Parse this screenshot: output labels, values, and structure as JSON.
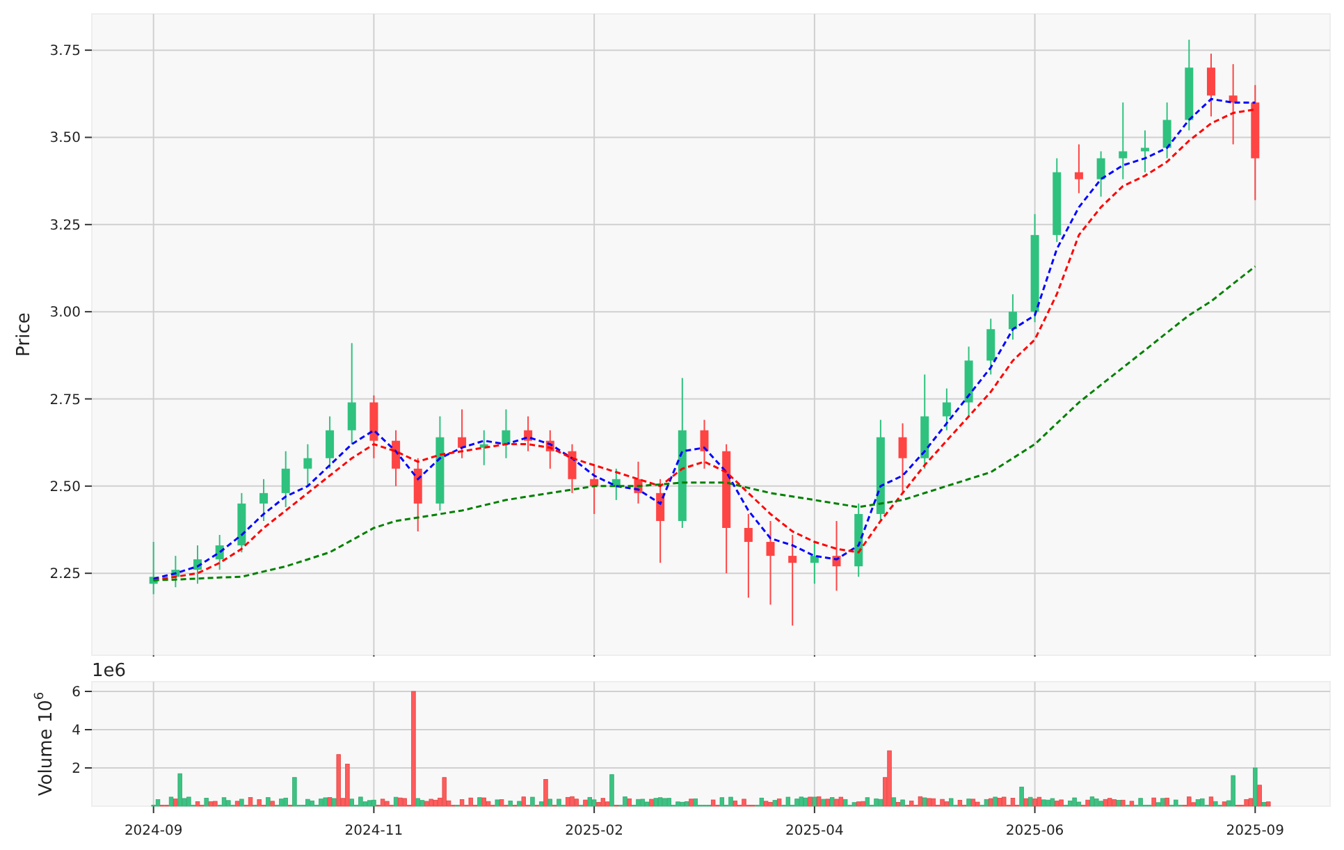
{
  "price_chart": {
    "chart_data": {
      "type": "candlestick",
      "ylabel": "Price",
      "grid": true,
      "categories": [
        null,
        null,
        null,
        null,
        null,
        null,
        null,
        null,
        null,
        null,
        null,
        null,
        null,
        null,
        null,
        null,
        null,
        null,
        null,
        null,
        null,
        null,
        null,
        null,
        null,
        null,
        null,
        null,
        null,
        null,
        null,
        null,
        null,
        null,
        null,
        null,
        null,
        null,
        null,
        null,
        null,
        null,
        null,
        null,
        null,
        null,
        null,
        null,
        null,
        null,
        null
      ],
      "ylim": [
        2.015,
        3.854
      ],
      "yticks": [
        {
          "value": 2.25,
          "label": "2.25"
        },
        {
          "value": 2.5,
          "label": "2.50"
        },
        {
          "value": 2.75,
          "label": "2.75"
        },
        {
          "value": 3,
          "label": "3.00"
        },
        {
          "value": 3.25,
          "label": "3.25"
        },
        {
          "value": 3.5,
          "label": "3.50"
        },
        {
          "value": 3.75,
          "label": "3.75"
        }
      ],
      "ohlc": [
        [
          2.22,
          2.34,
          2.19,
          2.24
        ],
        [
          2.24,
          2.3,
          2.21,
          2.26
        ],
        [
          2.26,
          2.33,
          2.22,
          2.29
        ],
        [
          2.29,
          2.36,
          2.26,
          2.33
        ],
        [
          2.33,
          2.48,
          2.31,
          2.45
        ],
        [
          2.45,
          2.52,
          2.4,
          2.48
        ],
        [
          2.48,
          2.6,
          2.44,
          2.55
        ],
        [
          2.55,
          2.62,
          2.5,
          2.58
        ],
        [
          2.58,
          2.7,
          2.55,
          2.66
        ],
        [
          2.66,
          2.91,
          2.62,
          2.74
        ],
        [
          2.74,
          2.76,
          2.58,
          2.63
        ],
        [
          2.63,
          2.66,
          2.5,
          2.55
        ],
        [
          2.55,
          2.58,
          2.37,
          2.45
        ],
        [
          2.45,
          2.7,
          2.43,
          2.64
        ],
        [
          2.64,
          2.72,
          2.58,
          2.61
        ],
        [
          2.61,
          2.66,
          2.56,
          2.62
        ],
        [
          2.62,
          2.72,
          2.58,
          2.66
        ],
        [
          2.66,
          2.7,
          2.6,
          2.63
        ],
        [
          2.63,
          2.66,
          2.55,
          2.6
        ],
        [
          2.6,
          2.62,
          2.48,
          2.52
        ],
        [
          2.52,
          2.56,
          2.42,
          2.5
        ],
        [
          2.5,
          2.55,
          2.46,
          2.52
        ],
        [
          2.52,
          2.57,
          2.45,
          2.48
        ],
        [
          2.48,
          2.52,
          2.28,
          2.4
        ],
        [
          2.4,
          2.81,
          2.38,
          2.66
        ],
        [
          2.66,
          2.69,
          2.55,
          2.6
        ],
        [
          2.6,
          2.62,
          2.25,
          2.38
        ],
        [
          2.38,
          2.42,
          2.18,
          2.34
        ],
        [
          2.34,
          2.4,
          2.16,
          2.3
        ],
        [
          2.3,
          2.36,
          2.1,
          2.28
        ],
        [
          2.28,
          2.34,
          2.22,
          2.3
        ],
        [
          2.3,
          2.4,
          2.2,
          2.27
        ],
        [
          2.27,
          2.45,
          2.24,
          2.42
        ],
        [
          2.42,
          2.69,
          2.4,
          2.64
        ],
        [
          2.64,
          2.68,
          2.48,
          2.58
        ],
        [
          2.58,
          2.82,
          2.55,
          2.7
        ],
        [
          2.7,
          2.78,
          2.66,
          2.74
        ],
        [
          2.74,
          2.9,
          2.7,
          2.86
        ],
        [
          2.86,
          2.98,
          2.82,
          2.95
        ],
        [
          2.95,
          3.05,
          2.92,
          3.0
        ],
        [
          3.0,
          3.28,
          2.97,
          3.22
        ],
        [
          3.22,
          3.44,
          3.2,
          3.4
        ],
        [
          3.4,
          3.48,
          3.34,
          3.38
        ],
        [
          3.38,
          3.46,
          3.33,
          3.44
        ],
        [
          3.44,
          3.6,
          3.38,
          3.46
        ],
        [
          3.46,
          3.52,
          3.4,
          3.47
        ],
        [
          3.47,
          3.6,
          3.44,
          3.55
        ],
        [
          3.55,
          3.78,
          3.52,
          3.7
        ],
        [
          3.7,
          3.74,
          3.56,
          3.62
        ],
        [
          3.62,
          3.71,
          3.48,
          3.6
        ],
        [
          3.6,
          3.65,
          3.32,
          3.44
        ]
      ],
      "series": [
        {
          "type": "line",
          "color": "#0000ff",
          "line_style": "dashed",
          "values": [
            2.234,
            2.25,
            2.27,
            2.31,
            2.36,
            2.42,
            2.47,
            2.5,
            2.56,
            2.62,
            2.66,
            2.6,
            2.52,
            2.58,
            2.61,
            2.63,
            2.62,
            2.64,
            2.62,
            2.58,
            2.53,
            2.5,
            2.49,
            2.45,
            2.6,
            2.61,
            2.54,
            2.43,
            2.35,
            2.33,
            2.3,
            2.29,
            2.33,
            2.5,
            2.53,
            2.6,
            2.68,
            2.76,
            2.84,
            2.95,
            2.99,
            3.18,
            3.3,
            3.38,
            3.42,
            3.44,
            3.47,
            3.55,
            3.61,
            3.6,
            3.6
          ]
        },
        {
          "type": "line",
          "color": "#ff0000",
          "line_style": "dashed",
          "values": [
            2.23,
            2.24,
            2.25,
            2.28,
            2.32,
            2.38,
            2.43,
            2.48,
            2.53,
            2.58,
            2.62,
            2.6,
            2.57,
            2.59,
            2.6,
            2.61,
            2.62,
            2.62,
            2.61,
            2.58,
            2.56,
            2.54,
            2.52,
            2.5,
            2.55,
            2.57,
            2.54,
            2.48,
            2.42,
            2.37,
            2.34,
            2.32,
            2.31,
            2.4,
            2.48,
            2.56,
            2.63,
            2.7,
            2.77,
            2.86,
            2.92,
            3.05,
            3.22,
            3.3,
            3.36,
            3.39,
            3.43,
            3.49,
            3.54,
            3.57,
            3.58
          ]
        },
        {
          "type": "line",
          "color": "#008000",
          "line_style": "dashed",
          "values": [
            2.23,
            2.232,
            2.235,
            2.238,
            2.24,
            2.255,
            2.27,
            2.29,
            2.31,
            2.345,
            2.38,
            2.4,
            2.41,
            2.42,
            2.43,
            2.445,
            2.46,
            2.47,
            2.48,
            2.49,
            2.5,
            2.5,
            2.5,
            2.505,
            2.51,
            2.51,
            2.51,
            2.495,
            2.48,
            2.47,
            2.46,
            2.45,
            2.44,
            2.45,
            2.46,
            2.48,
            2.5,
            2.52,
            2.54,
            2.58,
            2.62,
            2.68,
            2.74,
            2.79,
            2.84,
            2.89,
            2.94,
            2.99,
            3.03,
            3.08,
            3.13
          ]
        }
      ]
    }
  },
  "volume_panel": {
    "offset_label": "1e6",
    "ylabel": "Volume  10$^{6}$",
    "yticks": [
      "6",
      "4",
      "2"
    ],
    "xtick_labels": [
      "2024-09",
      "2024-11",
      "2025-02",
      "2025-04",
      "2025-06",
      "2025-09"
    ]
  }
}
